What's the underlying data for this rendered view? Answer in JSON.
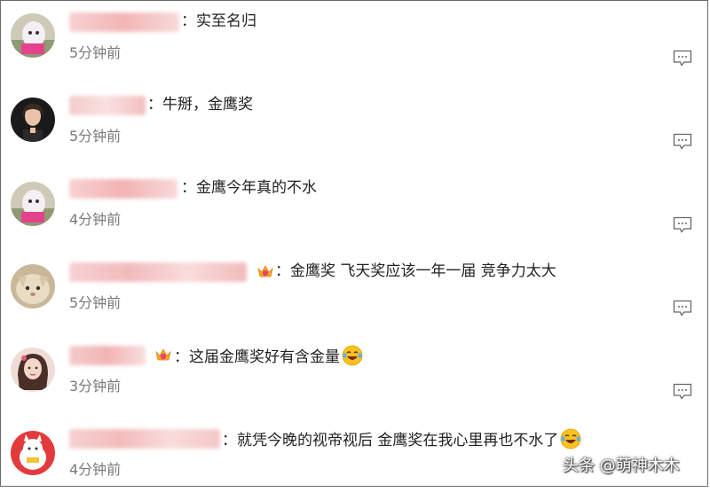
{
  "comments": [
    {
      "separator": "：",
      "text": "实至名归",
      "time": "5分钟前"
    },
    {
      "separator": "：",
      "text": "牛掰，金鹰奖",
      "time": "5分钟前"
    },
    {
      "separator": "：",
      "text": "金鹰今年真的不水",
      "time": "4分钟前"
    },
    {
      "separator": "：",
      "text": "金鹰奖 飞天奖应该一年一届 竞争力太大",
      "time": "5分钟前"
    },
    {
      "separator": "：",
      "text": "这届金鹰奖好有含金量",
      "time": "3分钟前"
    },
    {
      "separator": "：",
      "text": "就凭今晚的视帝视后 金鹰奖在我心里再也不水了",
      "time": "4分钟前"
    }
  ],
  "icons": {
    "reply": "comment-bubble-icon",
    "badge": "crown-badge-icon",
    "emoji": "laughing-tears-emoji"
  },
  "colors": {
    "text": "#222222",
    "time": "#7a7a7a",
    "blurred_name": "#f2b8b8",
    "border": "#6b6b6b"
  },
  "watermark": "头条 @萌神木木"
}
